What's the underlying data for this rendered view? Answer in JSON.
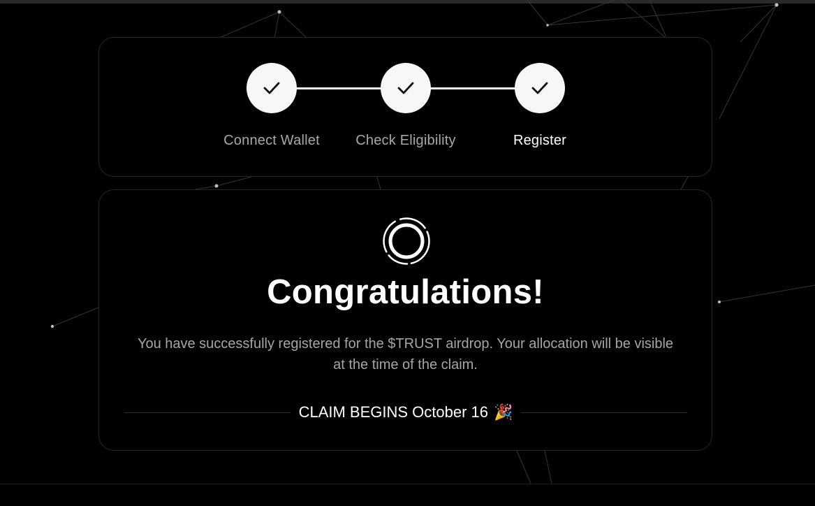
{
  "steps": [
    {
      "label": "Connect Wallet",
      "state": "complete",
      "icon": "check-icon"
    },
    {
      "label": "Check Eligibility",
      "state": "complete",
      "icon": "check-icon"
    },
    {
      "label": "Register",
      "state": "complete",
      "icon": "check-icon",
      "active": true
    }
  ],
  "result": {
    "icon": "spinner-ring-icon",
    "title": "Congratulations!",
    "message": "You have successfully registered for the $TRUST airdrop. Your allocation will be visible at the time of the claim.",
    "claim_text": "CLAIM BEGINS October 16",
    "claim_emoji": "🎉"
  },
  "colors": {
    "background": "#000000",
    "card_border": "#262626",
    "step_circle": "#f7f7f7",
    "muted_text": "#a6a6a6",
    "text": "#ffffff"
  }
}
